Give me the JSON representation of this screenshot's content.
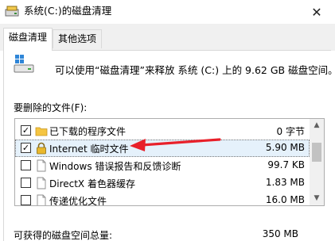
{
  "window": {
    "title": "系统(C:)的磁盘清理",
    "close_glyph": "✕"
  },
  "tabs": [
    {
      "label": "磁盘清理",
      "active": true
    },
    {
      "label": "其他选项",
      "active": false
    }
  ],
  "info": {
    "text": "可以使用“磁盘清理”来释放 系统 (C:) 上的 9.62 GB 磁盘空间。"
  },
  "files": {
    "section_label": "要删除的文件(F):",
    "items": [
      {
        "label": "已下载的程序文件",
        "size": "0 字节",
        "checked": true,
        "icon": "folder-icon"
      },
      {
        "label": "Internet 临时文件",
        "size": "5.90 MB",
        "checked": true,
        "icon": "lock-icon"
      },
      {
        "label": "Windows 错误报告和反馈诊断",
        "size": "99.7 KB",
        "checked": false,
        "icon": "file-icon"
      },
      {
        "label": "DirectX 着色器缓存",
        "size": "1.83 MB",
        "checked": false,
        "icon": "file-icon"
      },
      {
        "label": "传递优化文件",
        "size": "16.0 MB",
        "checked": false,
        "icon": "file-icon"
      }
    ],
    "check_glyph": "✓"
  },
  "total": {
    "label": "可获得的磁盘空间总量:",
    "value": "350 MB"
  },
  "annotation": {
    "arrow_color": "#e8202a"
  }
}
